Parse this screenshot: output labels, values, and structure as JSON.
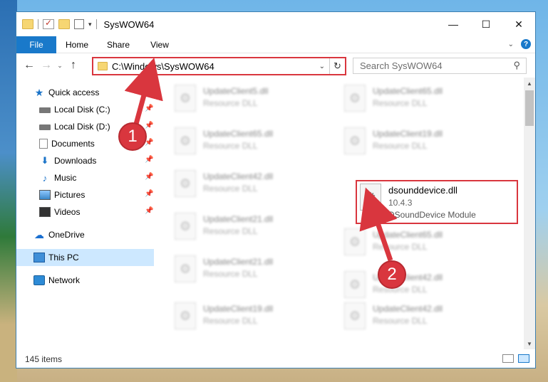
{
  "window": {
    "title": "SysWOW64",
    "controls": {
      "minimize": "—",
      "maximize": "☐",
      "close": "✕"
    }
  },
  "ribbon": {
    "tabs": [
      "File",
      "Home",
      "Share",
      "View"
    ],
    "collapse": "⌄",
    "help": "?"
  },
  "navigation": {
    "back": "←",
    "forward": "→",
    "recent": "⌄",
    "up": "↑",
    "address": "C:\\Windows\\SysWOW64",
    "address_dropdown": "⌄",
    "refresh": "↻",
    "search_placeholder": "Search SysWOW64",
    "search_icon": "⚲"
  },
  "sidebar": {
    "items": [
      {
        "label": "Quick access",
        "icon": "star-icon"
      },
      {
        "label": "Local Disk (C:)",
        "icon": "disk-icon",
        "pinned": true
      },
      {
        "label": "Local Disk (D:)",
        "icon": "disk-icon",
        "pinned": true
      },
      {
        "label": "Documents",
        "icon": "documents-icon",
        "pinned": true
      },
      {
        "label": "Downloads",
        "icon": "download-icon",
        "pinned": true
      },
      {
        "label": "Music",
        "icon": "music-icon",
        "pinned": true
      },
      {
        "label": "Pictures",
        "icon": "pictures-icon",
        "pinned": true
      },
      {
        "label": "Videos",
        "icon": "videos-icon",
        "pinned": true
      },
      {
        "label": "OneDrive",
        "icon": "cloud-icon"
      },
      {
        "label": "This PC",
        "icon": "pc-icon",
        "selected": true
      },
      {
        "label": "Network",
        "icon": "network-icon"
      }
    ]
  },
  "files": [
    {
      "name": "UpdateClient5.dll",
      "type": "Resource DLL"
    },
    {
      "name": "UpdateClient65.dll",
      "type": "Resource DLL"
    },
    {
      "name": "UpdateClient65.dll",
      "type": "Resource DLL"
    },
    {
      "name": "UpdateClient19.dll",
      "type": "Resource DLL"
    },
    {
      "name": "UpdateClient42.dll",
      "type": "Resource DLL"
    },
    {
      "name": "dsounddevice.dll",
      "version": "10.4.3",
      "type": "DSoundDevice Module",
      "highlighted": true
    },
    {
      "name": "UpdateClient21.dll",
      "type": "Resource DLL"
    },
    {
      "name": "UpdateClient65.dll",
      "type": "Resource DLL"
    },
    {
      "name": "UpdateClient21.dll",
      "type": "Resource DLL"
    },
    {
      "name": "UpdateClient42.dll",
      "type": "Resource DLL"
    },
    {
      "name": "UpdateClient19.dll",
      "type": "Resource DLL"
    },
    {
      "name": "UpdateClient42.dll",
      "type": "Resource DLL"
    }
  ],
  "status": {
    "item_count": "145 items"
  },
  "annotations": {
    "callout_1": "1",
    "callout_2": "2",
    "color": "#d9363e"
  }
}
